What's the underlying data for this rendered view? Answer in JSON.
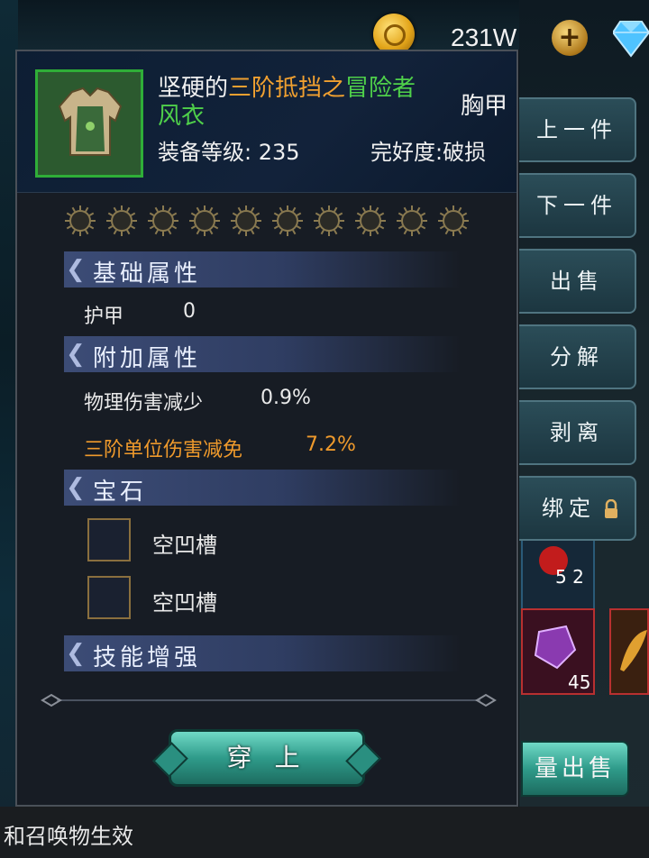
{
  "currency": {
    "gold_value": "231W",
    "plus_symbol": "+"
  },
  "item": {
    "name_part1": "坚硬的",
    "name_part2": "三阶抵挡之",
    "name_part3": "冒险者",
    "name_part4": "风衣",
    "slot_type": "胸甲",
    "level_text": "装备等级: 235",
    "durability_text": "完好度:破损",
    "star_count": 10,
    "stars_filled": 0
  },
  "sections": {
    "base": {
      "title": "基础属性",
      "stats": [
        {
          "name": "护甲",
          "value": "0"
        }
      ]
    },
    "extra": {
      "title": "附加属性",
      "stats": [
        {
          "name": "物理伤害减少",
          "value": "0.9%"
        },
        {
          "name": "三阶单位伤害减免",
          "value": "7.2%"
        }
      ]
    },
    "gems": {
      "title": "宝石",
      "slots": [
        "空凹槽",
        "空凹槽"
      ]
    },
    "skills": {
      "title": "技能增强"
    }
  },
  "actions": {
    "equip": "穿 上"
  },
  "side_buttons": [
    "上一件",
    "下一件",
    "出售",
    "分解",
    "剥离",
    "绑定"
  ],
  "bulk_sell": "量出售",
  "inventory": {
    "slot1_count": "5 2",
    "slot2_count": "45"
  },
  "bottom_text": "和召唤物生效",
  "colors": {
    "quality_orange": "#f0a030",
    "quality_green": "#4fd04a",
    "frame_green": "#2fae38"
  }
}
